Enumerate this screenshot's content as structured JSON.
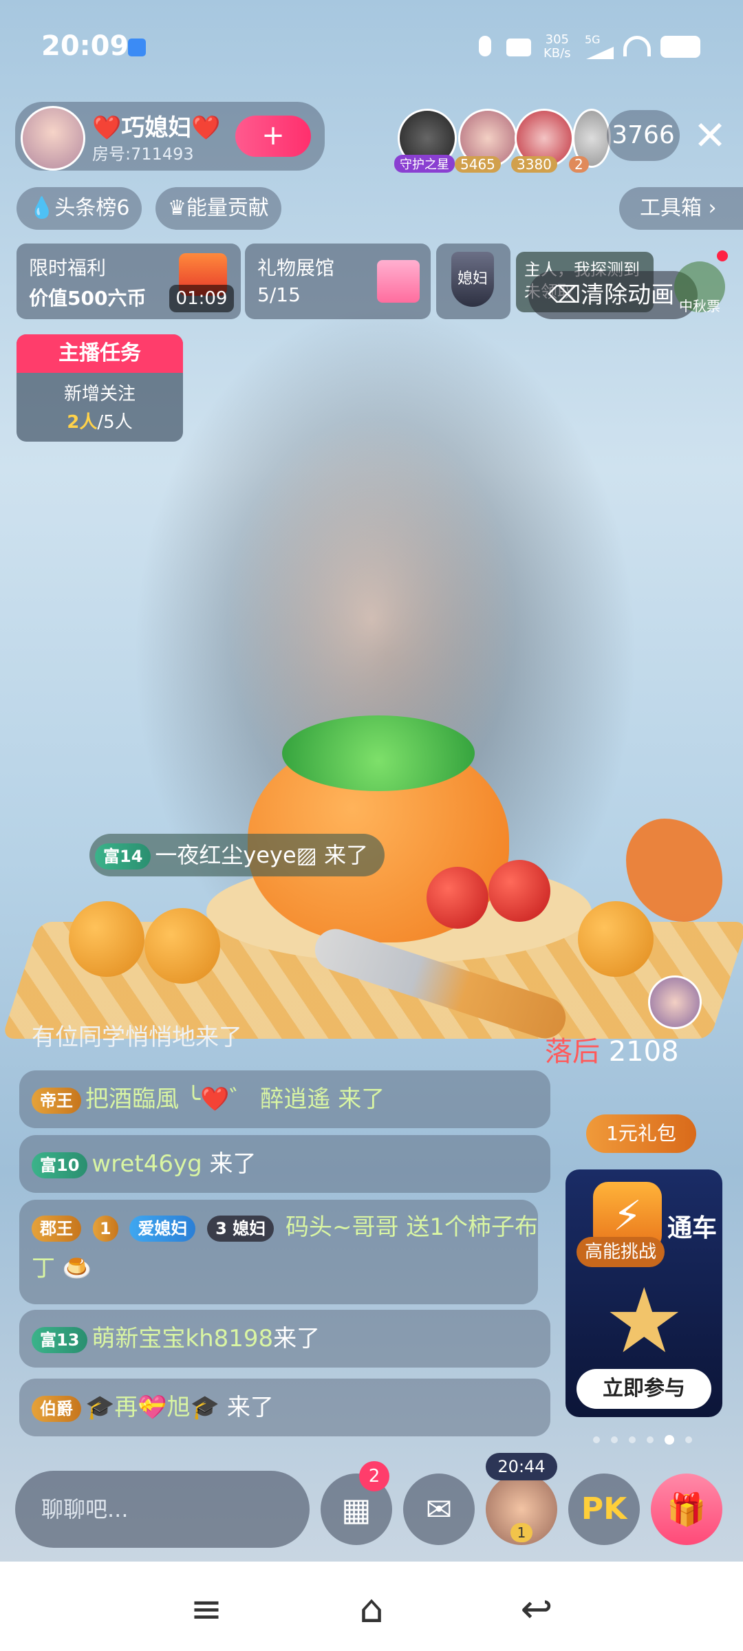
{
  "status_bar": {
    "time": "20:09",
    "net_speed_top": "305",
    "net_speed_unit": "KB/s",
    "network": "5G"
  },
  "host": {
    "name": "❤️巧媳妇❤️",
    "room_id": "房号:711493"
  },
  "viewers": [
    {
      "badge": "守护之星"
    },
    {
      "badge": "5465"
    },
    {
      "badge": "3380"
    },
    {
      "badge": "2"
    }
  ],
  "viewer_count": "3766",
  "chips": {
    "headline": "头条榜6",
    "energy": "能量贡献",
    "toolbox": "工具箱"
  },
  "cards": {
    "welfare_title": "限时福利",
    "welfare_value": "价值500六币",
    "welfare_timer": "01:09",
    "gallery_title": "礼物展馆",
    "gallery_progress": "5/15",
    "fan_badge": "媳妇",
    "tip_text": "主人，我探测到未领取",
    "clear_animation": "清除动画",
    "festival": "中秋票"
  },
  "task": {
    "title": "主播任务",
    "line1": "新增关注",
    "progress_done": "2人",
    "progress_total": "/5人"
  },
  "gift_overlay": {
    "arrival_badge": "富14",
    "arrival_text": "一夜红尘yeye▨ 来了"
  },
  "pk": {
    "status": "落后",
    "score": "2108",
    "gift_pack": "1元礼包"
  },
  "promo": {
    "badge": "高能挑战",
    "title_fragment": "通车",
    "button": "立即参与"
  },
  "chat": [
    {
      "plain": "有位同学悄悄地来了"
    },
    {
      "badge": "帝王",
      "text": "把酒臨風 ╰❤️゛ 醉逍遙 来了"
    },
    {
      "badge": "富10",
      "name": "wret46yg",
      "text": "来了"
    },
    {
      "badge": "郡王",
      "level": "1",
      "fan1": "爱媳妇",
      "fan2_level": "3",
      "fan2": "媳妇",
      "name": "码头~哥哥",
      "text": "送1个柿子布丁"
    },
    {
      "badge": "富13",
      "name": "萌新宝宝kh8198",
      "text": "来了"
    },
    {
      "badge": "伯爵",
      "name": "🎓再💝旭🎓",
      "text": "来了"
    }
  ],
  "bottom": {
    "chat_placeholder": "聊聊吧...",
    "apps_badge": "2",
    "timer": "20:44",
    "mic_level": "1",
    "pk_label": "PK"
  }
}
